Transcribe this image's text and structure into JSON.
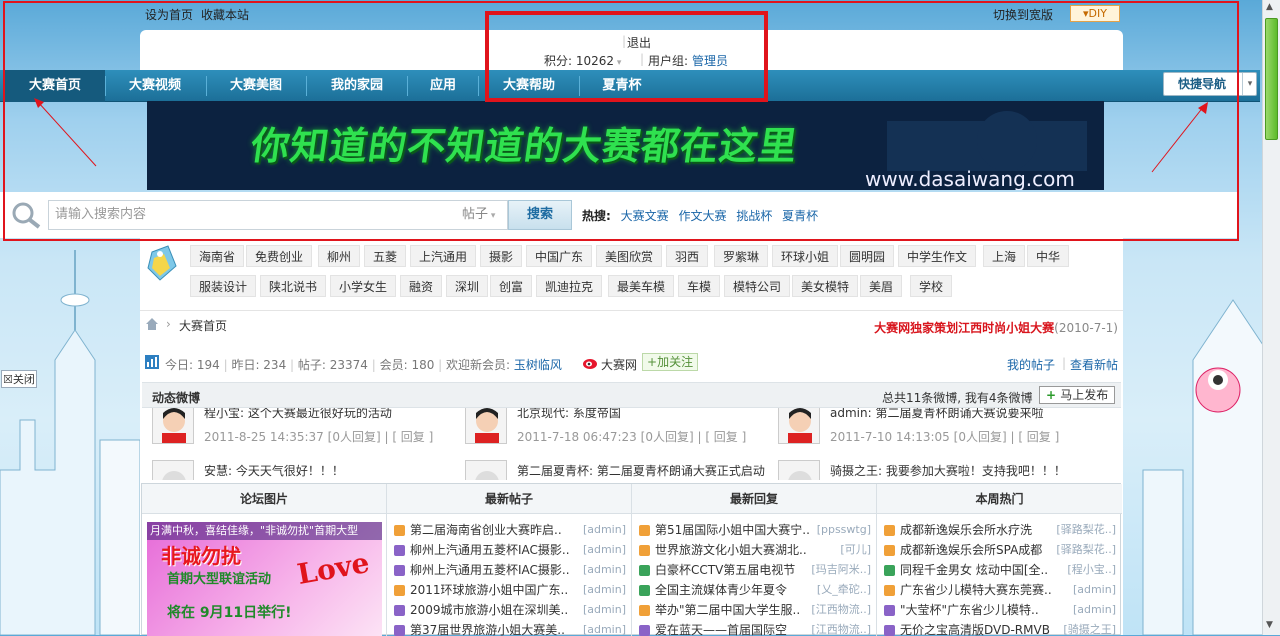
{
  "top": {
    "set_home": "设为首页",
    "bookmark": "收藏本站",
    "switch_wide": "切换到宽版",
    "diy": "DIY"
  },
  "user": {
    "logout": "退出",
    "points_label": "积分: 10262",
    "group_label": "用户组:",
    "group_value": "管理员"
  },
  "nav": {
    "items": [
      "大赛首页",
      "大赛视频",
      "大赛美图",
      "我的家园",
      "应用",
      "大赛帮助",
      "夏青杯"
    ],
    "active": 0,
    "quick": "快捷导航"
  },
  "banner": {
    "slogan": "你知道的不知道的大赛都在这里",
    "url": "www.dasaiwang.com"
  },
  "search": {
    "placeholder": "请输入搜索内容",
    "type": "帖子",
    "button": "搜索",
    "hot_label": "热搜:",
    "hot": [
      "大赛文赛",
      "作文大赛",
      "挑战杯",
      "夏青杯"
    ]
  },
  "tags": {
    "row1": [
      "海南省",
      "免费创业",
      "柳州",
      "五菱",
      "上汽通用",
      "摄影",
      "中国广东",
      "美图欣赏",
      "羽西",
      "罗紫琳",
      "环球小姐",
      "圆明园",
      "中学生作文",
      "上海",
      "中华"
    ],
    "row2": [
      "服装设计",
      "陕北说书",
      "小学女生",
      "融资",
      "深圳",
      "创富",
      "凯迪拉克",
      "最美车模",
      "车模",
      "模特公司",
      "美女模特",
      "美眉",
      "学校"
    ]
  },
  "breadcrumb": {
    "home": "大赛首页",
    "announce": "大赛网独家策划江西时尚小姐大赛",
    "announce_date": "(2010-7-1)"
  },
  "stats": {
    "today": "今日: 194",
    "yesterday": "昨日: 234",
    "posts": "帖子: 23374",
    "members": "会员: 180",
    "welcome": "欢迎新会员:",
    "new_member": "玉树临风",
    "weibo": "大赛网",
    "follow": "加关注",
    "my_posts": "我的帖子",
    "new_posts": "查看新帖"
  },
  "feed": {
    "title": "动态微博",
    "summary": "总共11条微博, 我有4条微博",
    "publish": "马上发布",
    "items": [
      {
        "text": "程小宝: 这个大赛最近很好玩的活动",
        "time": "2011-8-25 14:35:37",
        "reply": "[0人回复]",
        "action": "[ 回复 ]"
      },
      {
        "text": "北京现代: 系度帝国",
        "time": "2011-7-18 06:47:23",
        "reply": "[0人回复]",
        "action": "[ 回复 ]"
      },
      {
        "text": "admin: 第二届夏青杯朗诵大赛说要来啦",
        "time": "2011-7-10 14:13:05",
        "reply": "[0人回复]",
        "action": "[ 回复 ]"
      }
    ],
    "items2": [
      "安慧: 今天天气很好！！！",
      "第二届夏青杯: 第二届夏青杯朗诵大赛正式启动",
      "骑摄之王: 我要参加大赛啦！支持我吧！！！"
    ]
  },
  "grid": {
    "heads": [
      "论坛图片",
      "最新帖子",
      "最新回复",
      "本周热门"
    ],
    "image_text": {
      "top": "月满中秋，喜结佳缘，\"非诚勿扰\"首期大型",
      "title": "非诚勿扰",
      "sub": "首期大型联谊活动",
      "love": "Love",
      "date": "将在 9月11日举行!"
    },
    "latest": [
      {
        "t": "第二届海南省创业大赛昨启..",
        "a": "[admin]",
        "c": "#f0a038"
      },
      {
        "t": "柳州上汽通用五菱杯IAC摄影..",
        "a": "[admin]",
        "c": "#8a63c7"
      },
      {
        "t": "柳州上汽通用五菱杯IAC摄影..",
        "a": "[admin]",
        "c": "#8a63c7"
      },
      {
        "t": "2011环球旅游小姐中国广东..",
        "a": "[admin]",
        "c": "#f0a038"
      },
      {
        "t": "2009城市旅游小姐在深圳美..",
        "a": "[admin]",
        "c": "#8a63c7"
      },
      {
        "t": "第37届世界旅游小姐大赛美..",
        "a": "[admin]",
        "c": "#8a63c7"
      }
    ],
    "replies": [
      {
        "t": "第51届国际小姐中国大赛宁..",
        "a": "[ppsswtg]",
        "c": "#f0a038"
      },
      {
        "t": "世界旅游文化小姐大赛湖北..",
        "a": "[可儿]",
        "c": "#f0a038"
      },
      {
        "t": "白豪杯CCTV第五届电视节",
        "a": "[玛吉阿米..]",
        "c": "#3aa35a"
      },
      {
        "t": "全国主流媒体青少年夏令",
        "a": "[乂_牵砣..]",
        "c": "#3aa35a"
      },
      {
        "t": "举办\"第二届中国大学生服..",
        "a": "[江西物流..]",
        "c": "#f0a038"
      },
      {
        "t": "爱在蓝天——首届国际空",
        "a": "[江西物流..]",
        "c": "#8a63c7"
      }
    ],
    "hot": [
      {
        "t": "成都新逸娱乐会所水疗洗",
        "a": "[驿路梨花..]",
        "c": "#f0a038"
      },
      {
        "t": "成都新逸娱乐会所SPA成都",
        "a": "[驿路梨花..]",
        "c": "#f0a038"
      },
      {
        "t": "同程千金男女 炫动中国[全..",
        "a": "[程小宝..]",
        "c": "#3aa35a"
      },
      {
        "t": "广东省少儿模特大赛东莞赛..",
        "a": "[admin]",
        "c": "#f0a038"
      },
      {
        "t": "\"大莹杯\"广东省少儿模特..",
        "a": "[admin]",
        "c": "#8a63c7"
      },
      {
        "t": "无价之宝高清版DVD-RMVB",
        "a": "[骑摄之王]",
        "c": "#8a63c7"
      }
    ]
  },
  "side": {
    "close": "关闭"
  }
}
